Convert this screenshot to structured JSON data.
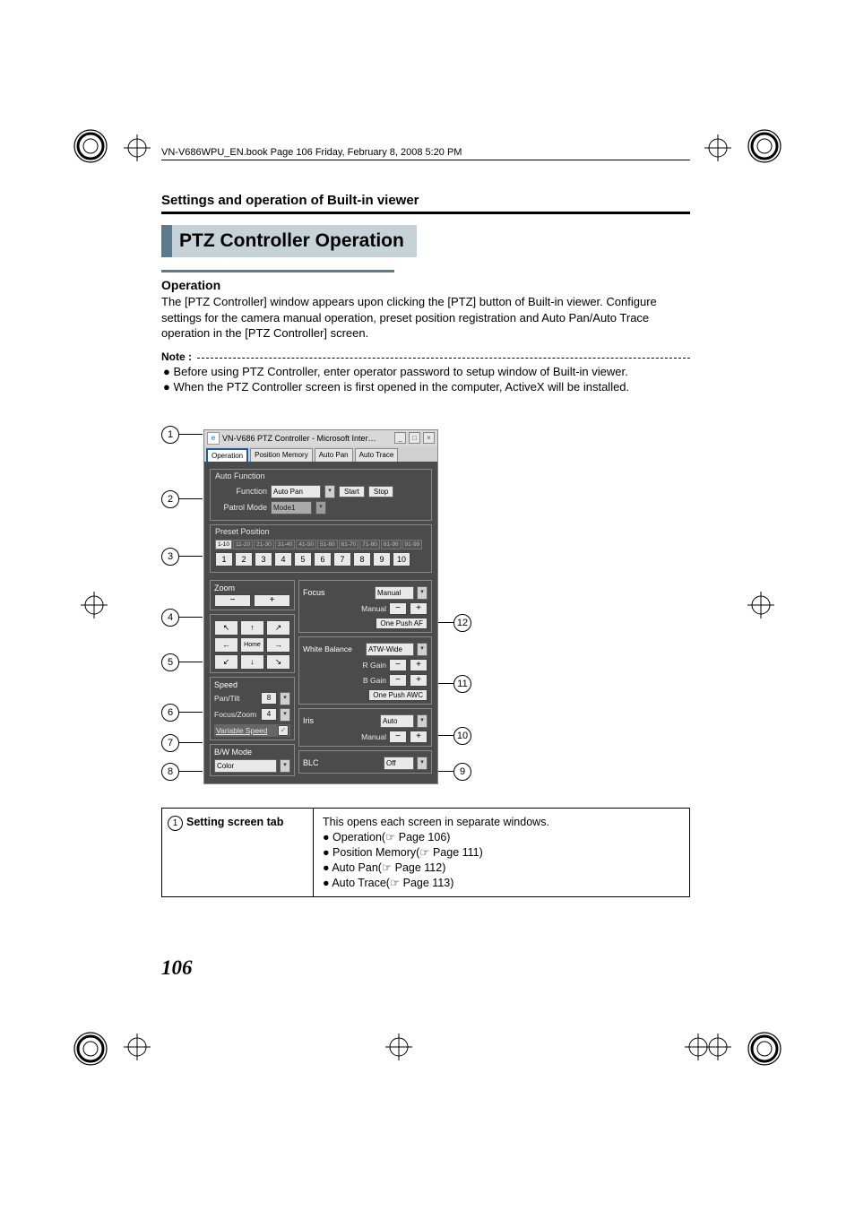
{
  "header_line": "VN-V686WPU_EN.book  Page 106  Friday, February 8, 2008  5:20 PM",
  "section_heading": "Settings and operation of Built-in viewer",
  "title": "PTZ Controller Operation",
  "subheading": "Operation",
  "intro_para": "The [PTZ Controller] window appears upon clicking the [PTZ] button of Built-in viewer. Configure settings for the camera manual operation, preset position registration and Auto Pan/Auto Trace operation in the [PTZ Controller] screen.",
  "note_label": "Note :",
  "notes": [
    "Before using PTZ Controller, enter operator password to setup window of Built-in viewer.",
    "When the PTZ Controller screen is first opened in the computer, ActiveX will be installed."
  ],
  "callouts_left": [
    "1",
    "2",
    "3",
    "4",
    "5",
    "6",
    "7",
    "8"
  ],
  "callouts_right": [
    "12",
    "11",
    "10",
    "9"
  ],
  "ptz": {
    "titlebar_left": "VN-V686 PTZ Controller -",
    "titlebar_right": "Microsoft Inter…",
    "tabs": [
      "Operation",
      "Position Memory",
      "Auto Pan",
      "Auto Trace"
    ],
    "auto_function": {
      "title": "Auto Function",
      "function_label": "Function",
      "function_value": "Auto Pan",
      "start": "Start",
      "stop": "Stop",
      "patrol_label": "Patrol Mode",
      "patrol_value": "Mode1"
    },
    "preset": {
      "title": "Preset Position",
      "ranges": [
        "1-10",
        "11-20",
        "21-30",
        "31-40",
        "41-50",
        "51-60",
        "61-70",
        "71-80",
        "81-90",
        "91-99"
      ],
      "nums": [
        "1",
        "2",
        "3",
        "4",
        "5",
        "6",
        "7",
        "8",
        "9",
        "10"
      ]
    },
    "zoom_label": "Zoom",
    "pan_home": "Home",
    "speed_label": "Speed",
    "speed_pantilt": "Pan/Tilt",
    "speed_pantilt_val": "8",
    "speed_focuszoom": "Focus/Zoom",
    "speed_focuszoom_val": "4",
    "variable_speed": "Variable Speed",
    "bw_label": "B/W Mode",
    "bw_value": "Color",
    "focus_label": "Focus",
    "focus_mode": "Manual",
    "focus_manual": "Manual",
    "focus_btn": "One Push AF",
    "wb_label": "White Balance",
    "wb_value": "ATW-Wide",
    "rgain": "R Gain",
    "bgain": "B Gain",
    "awc_btn": "One Push AWC",
    "iris_label": "Iris",
    "iris_value": "Auto",
    "iris_manual": "Manual",
    "blc_label": "BLC",
    "blc_value": "Off"
  },
  "desc_row": {
    "num": "1",
    "label": "Setting screen tab",
    "text": "This opens each screen in separate windows.",
    "items": [
      "Operation(☞ Page 106)",
      "Position Memory(☞ Page 111)",
      "Auto Pan(☞ Page 112)",
      "Auto Trace(☞ Page 113)"
    ]
  },
  "page_number": "106"
}
